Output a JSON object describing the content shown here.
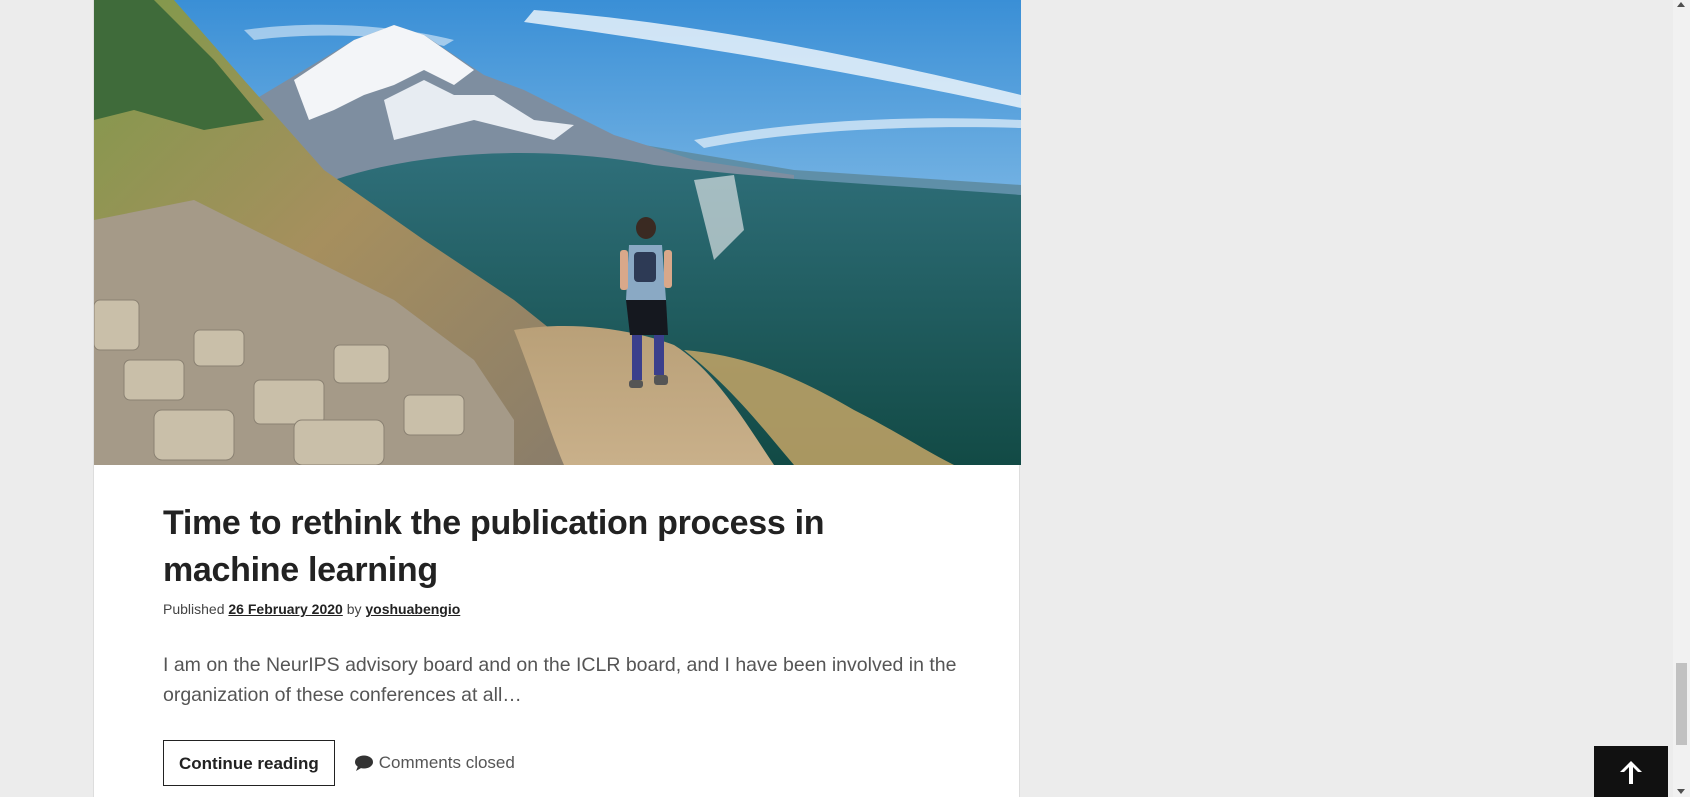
{
  "post": {
    "title": "Time to rethink the publication process in machine learning",
    "meta_published_label": "Published",
    "date": "26 February 2020",
    "meta_by_label": "by",
    "author": "yoshuabengio",
    "excerpt": "I am on the NeurIPS advisory board and on the ICLR board, and I have been involved in the organization of these conferences at all…",
    "continue_label": "Continue reading",
    "comments_label": "Comments closed",
    "featured_image": "mountain-trail-runner-photo"
  },
  "ui": {
    "back_to_top_icon": "arrow-up-icon",
    "colors": {
      "page_bg": "#ececec",
      "card_bg": "#ffffff",
      "title": "#222222",
      "text": "#555555",
      "button_dark": "#111111"
    }
  }
}
